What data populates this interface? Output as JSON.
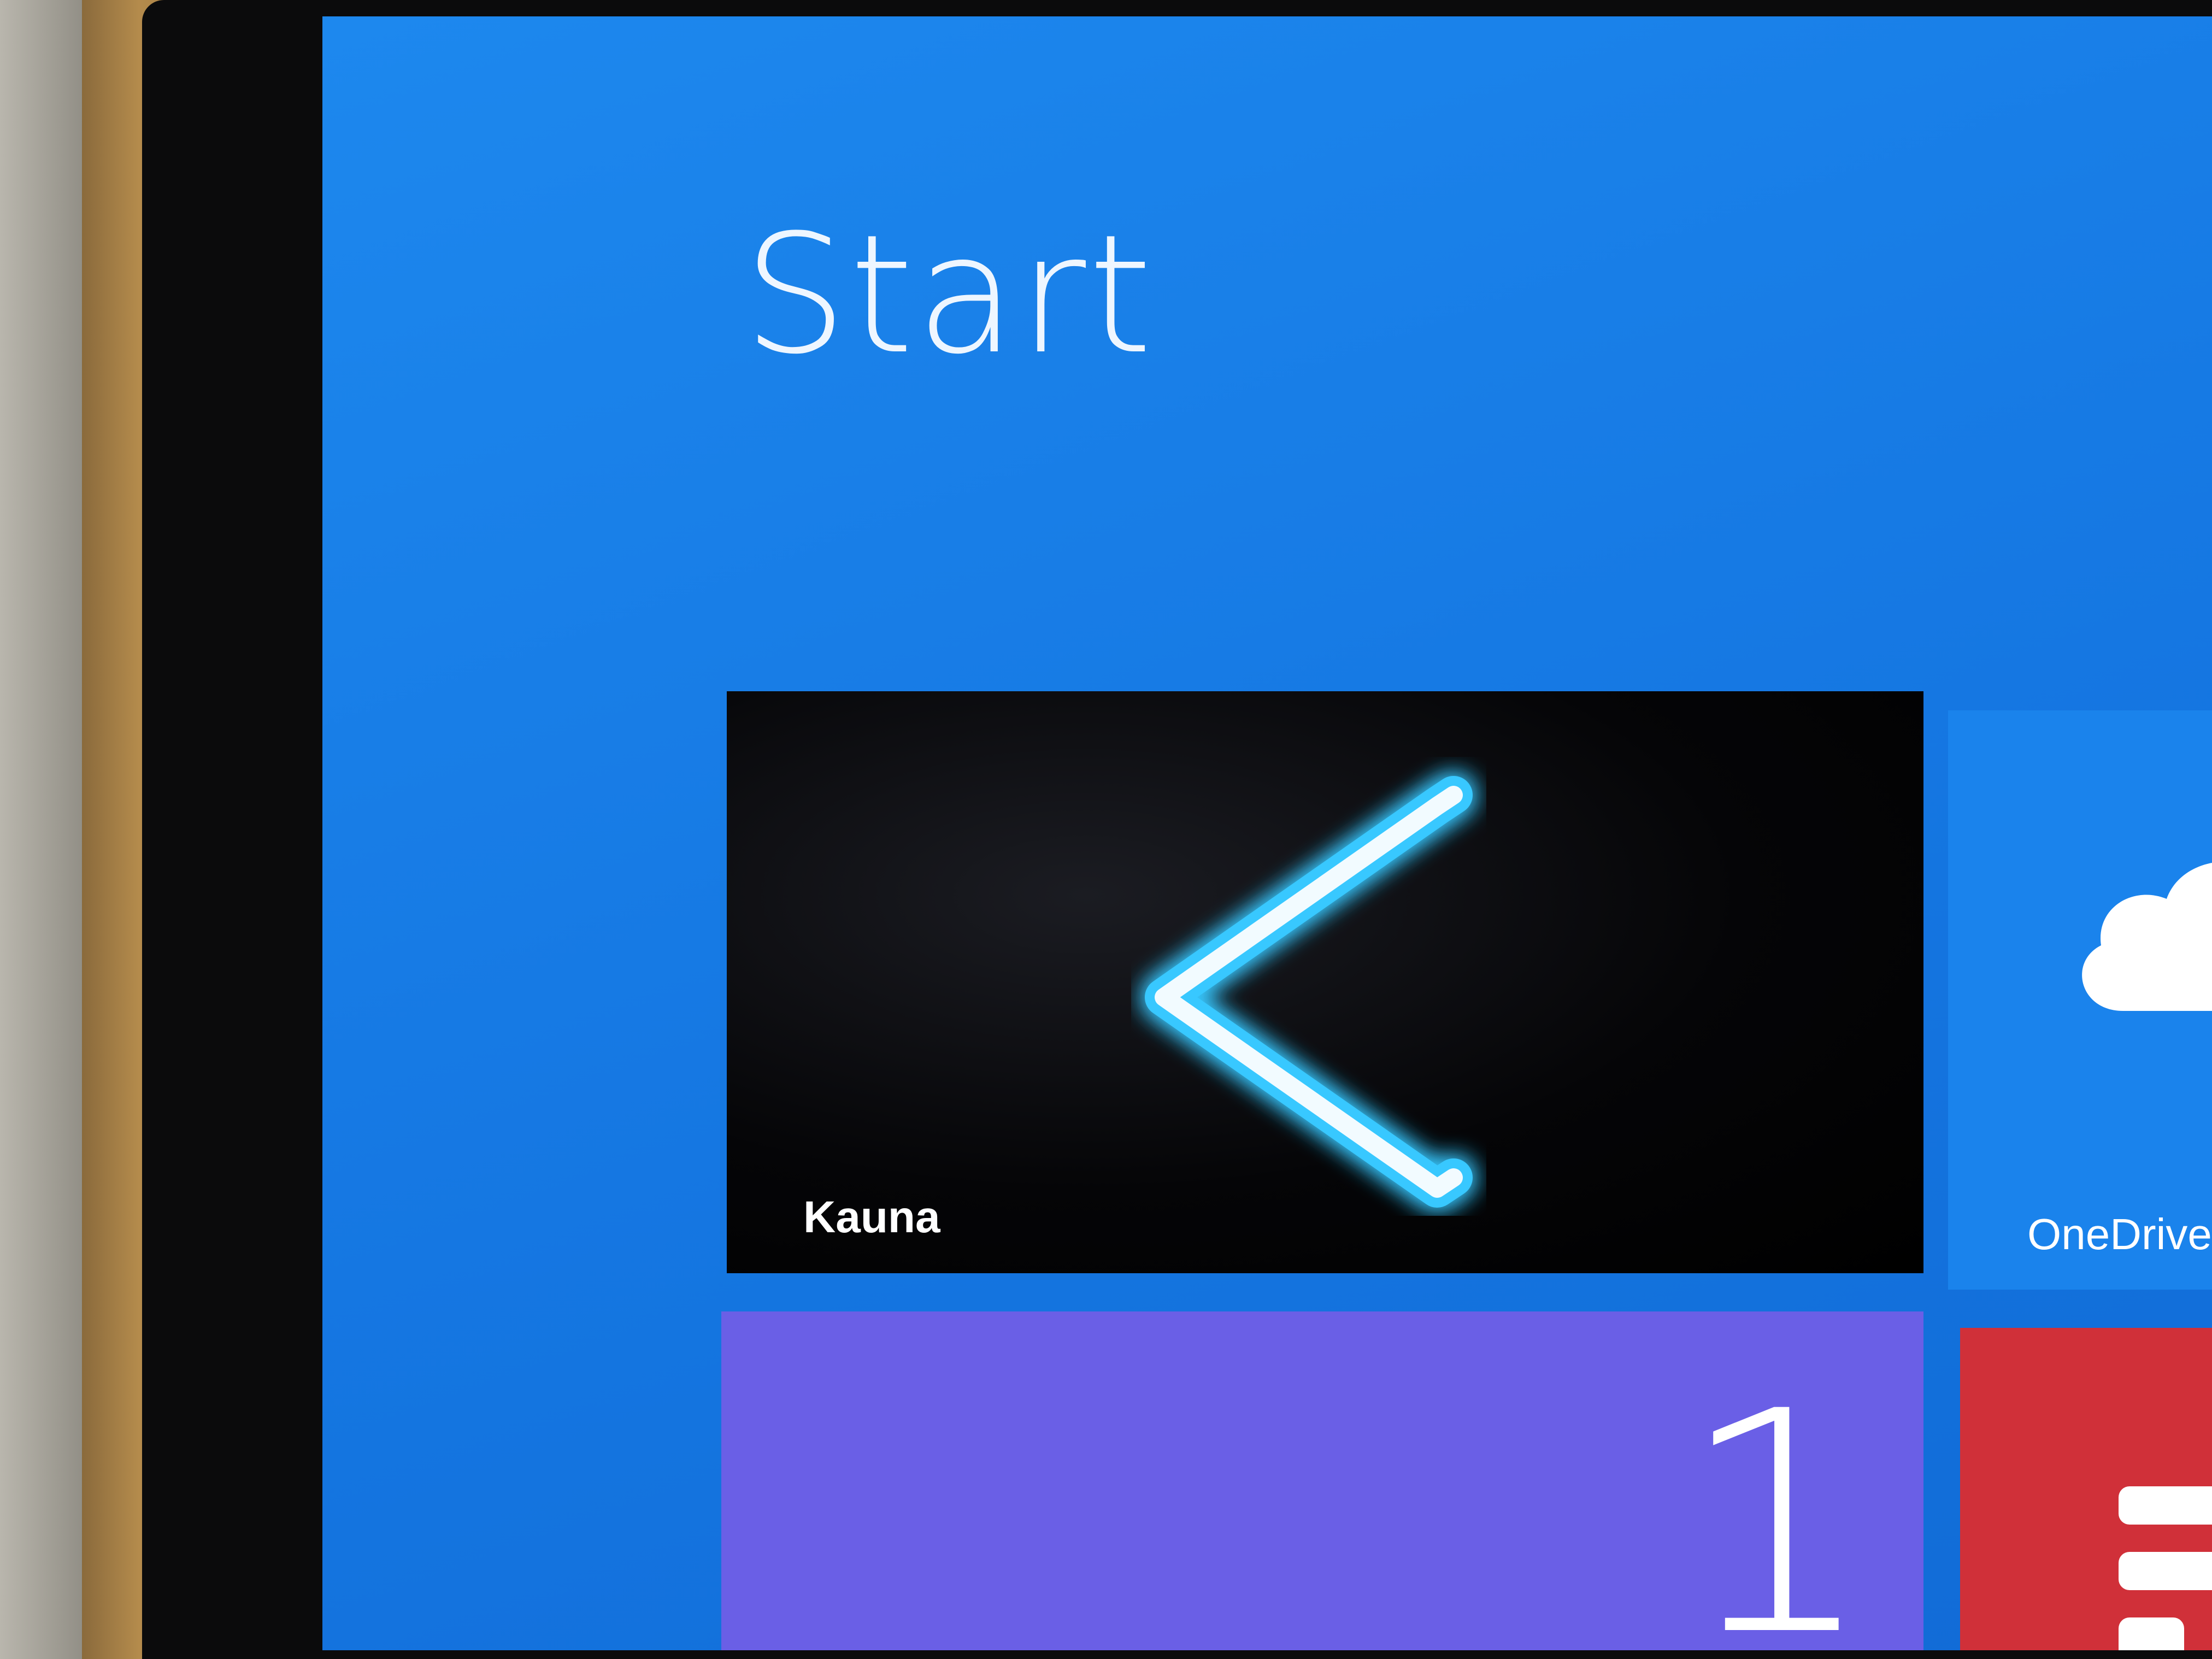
{
  "start_screen": {
    "title": "Start"
  },
  "tiles": {
    "kauna": {
      "label": "Kauna",
      "icon": "chevron-left-icon"
    },
    "onedrive": {
      "label": "OneDrive",
      "icon": "cloud-icon"
    },
    "purple": {
      "count": "1"
    },
    "red": {
      "icon": "app-glyph-icon"
    }
  },
  "colors": {
    "start_background": "#1577e2",
    "kauna_tile": "#000000",
    "onedrive_tile": "#1a83ec",
    "purple_tile": "#6a5fe6",
    "red_tile": "#d03039",
    "chevron_glow": "#38c8ff"
  }
}
